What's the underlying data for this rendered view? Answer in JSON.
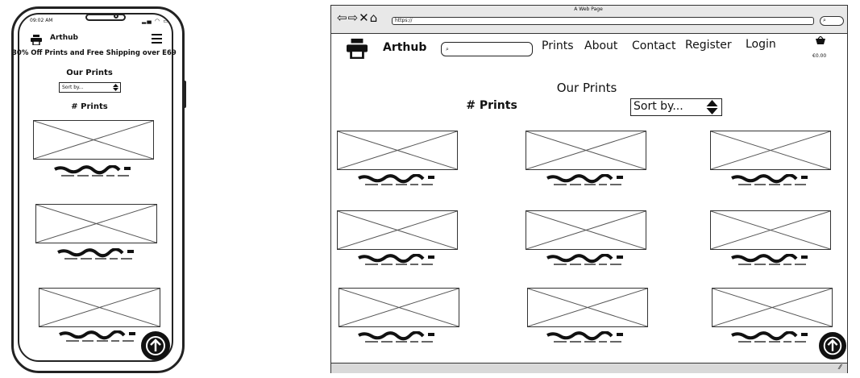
{
  "mobile": {
    "status_time": "09:02 AM",
    "brand": "Arthub",
    "promo_text": "30% Off Prints and Free Shipping over E69",
    "page_title": "Our Prints",
    "sort_label": "Sort by...",
    "count_label": "# Prints",
    "icons": {
      "logo": "printer-icon",
      "menu": "hamburger-icon",
      "scroll_top": "arrow-up-icon"
    }
  },
  "browser": {
    "window_title": "A Web Page",
    "url": "https://",
    "brand": "Arthub",
    "nav": [
      "Prints",
      "About",
      "Contact",
      "Register",
      "Login"
    ],
    "cart_total": "€0.00",
    "page_title": "Our Prints",
    "count_label": "# Prints",
    "sort_label": "Sort by...",
    "icons": {
      "logo": "printer-icon",
      "cart": "basket-icon",
      "search": "search-icon",
      "scroll_top": "arrow-up-icon"
    }
  },
  "colors": {
    "ink": "#111111",
    "chrome": "#e8e8e8",
    "footer": "#d9d9d9"
  }
}
